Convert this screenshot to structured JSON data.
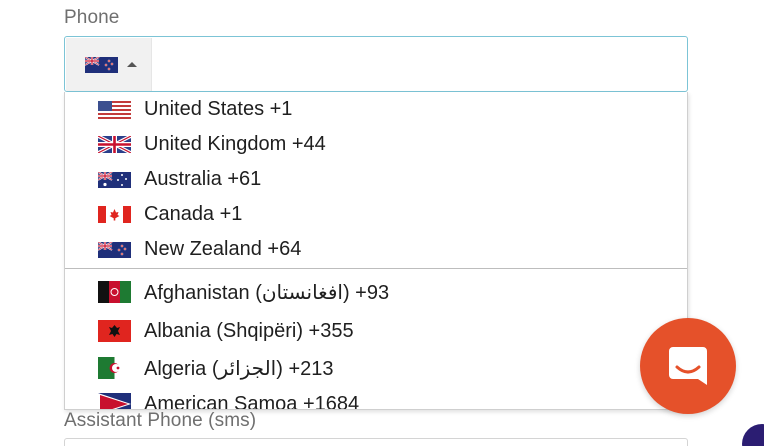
{
  "form": {
    "phone_label": "Phone",
    "assistant_phone_label": "Assistant Phone (sms)"
  },
  "phone_input": {
    "selected_flag": "new-zealand-flag-icon",
    "dropdown_state": "open"
  },
  "countries": [
    {
      "name": "United States +1",
      "flag": "us-flag-icon"
    },
    {
      "name": "United Kingdom +44",
      "flag": "uk-flag-icon"
    },
    {
      "name": "Australia +61",
      "flag": "australia-flag-icon"
    },
    {
      "name": "Canada +1",
      "flag": "canada-flag-icon"
    },
    {
      "name": "New Zealand +64",
      "flag": "new-zealand-flag-icon"
    },
    {
      "name": "Afghanistan (‫افغانستان‬‎) +93",
      "flag": "afghanistan-flag-icon"
    },
    {
      "name": "Albania (Shqipëri) +355",
      "flag": "albania-flag-icon"
    },
    {
      "name": "Algeria (‫الجزائر‬‎) +213",
      "flag": "algeria-flag-icon"
    },
    {
      "name": "American Samoa +1684",
      "flag": "american-samoa-flag-icon"
    }
  ],
  "colors": {
    "accent_border": "#7cc4d6",
    "chat_button": "#e5512a"
  },
  "chat_widget": {
    "icon": "chat-icon"
  }
}
